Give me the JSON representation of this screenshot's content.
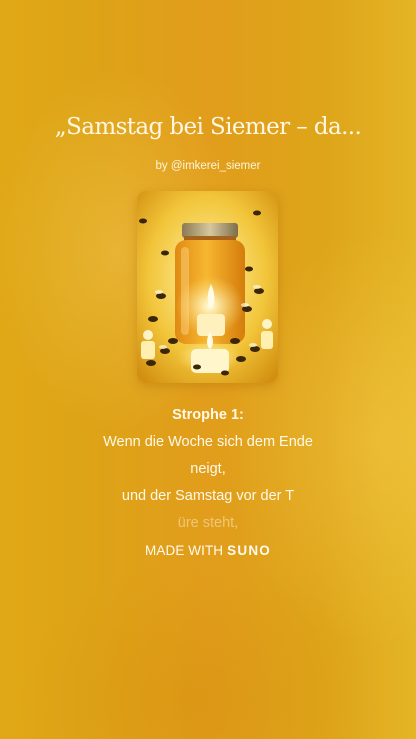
{
  "song": {
    "title": "„Samstag bei Siemer – da...",
    "byline": "by @imkerei_siemer"
  },
  "cover": {
    "icon": "honey-jar-candles-bees-artwork"
  },
  "lyrics": {
    "heading": "Strophe 1:",
    "lines": [
      "Wenn die Woche sich dem Ende",
      "neigt,",
      "und der Samstag vor der T",
      "üre steht,"
    ]
  },
  "footer": {
    "made_with": "MADE WITH",
    "brand": "SUNO"
  },
  "colors": {
    "background": "#e0a817",
    "text": "#fff7e3"
  }
}
